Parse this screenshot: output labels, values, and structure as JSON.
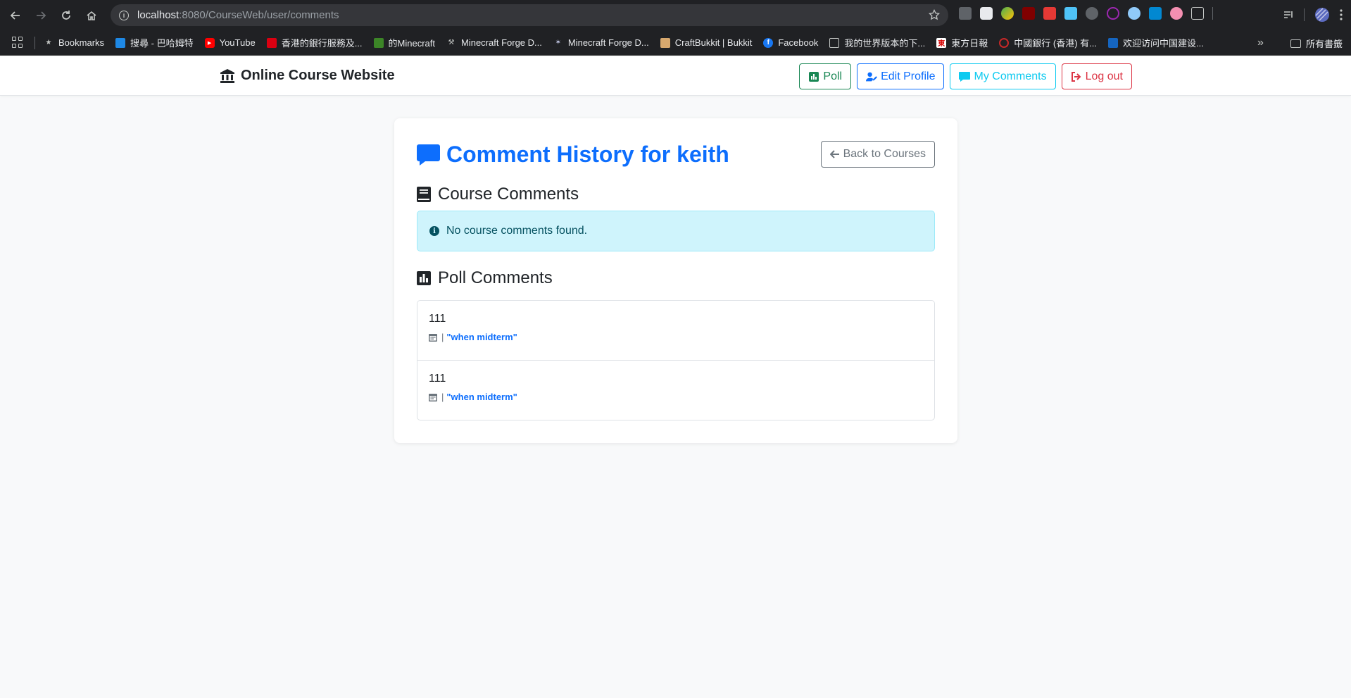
{
  "browser": {
    "url_host": "localhost",
    "url_path": ":8080/CourseWeb/user/comments",
    "bookmarks": [
      {
        "label": "Bookmarks",
        "icon": "star-icon"
      },
      {
        "label": "搜尋 - 巴哈姆特",
        "icon": "bahamut-icon"
      },
      {
        "label": "YouTube",
        "icon": "youtube-icon"
      },
      {
        "label": "香港的銀行服務及...",
        "icon": "hsbc-icon"
      },
      {
        "label": "的Minecraft",
        "icon": "minecraft-icon"
      },
      {
        "label": "Minecraft Forge D...",
        "icon": "forge-icon"
      },
      {
        "label": "Minecraft Forge D...",
        "icon": "forge-anvil-icon"
      },
      {
        "label": "CraftBukkit | Bukkit",
        "icon": "bukkit-icon"
      },
      {
        "label": "Facebook",
        "icon": "facebook-icon"
      },
      {
        "label": "我的世界版本的下...",
        "icon": "image-icon"
      },
      {
        "label": "東方日報",
        "icon": "oriental-daily-icon"
      },
      {
        "label": "中國銀行 (香港) 有...",
        "icon": "boc-icon"
      },
      {
        "label": "欢迎访问中国建设...",
        "icon": "ccb-icon"
      }
    ],
    "all_bookmarks": "所有書籤"
  },
  "navbar": {
    "brand": "Online Course Website",
    "poll": "Poll",
    "edit_profile": "Edit Profile",
    "my_comments": "My Comments",
    "logout": "Log out"
  },
  "page": {
    "title": "Comment History for keith",
    "back": "Back to Courses",
    "course_section": "Course Comments",
    "no_course_comments": "No course comments found.",
    "poll_section": "Poll Comments",
    "poll_comments": [
      {
        "text": "111",
        "separator": "|",
        "link": "\"when midterm\""
      },
      {
        "text": "111",
        "separator": "|",
        "link": "\"when midterm\""
      }
    ]
  },
  "colors": {
    "primary": "#0d6efd",
    "success": "#198754",
    "info": "#0dcaf0",
    "danger": "#dc3545",
    "secondary": "#6c757d"
  }
}
